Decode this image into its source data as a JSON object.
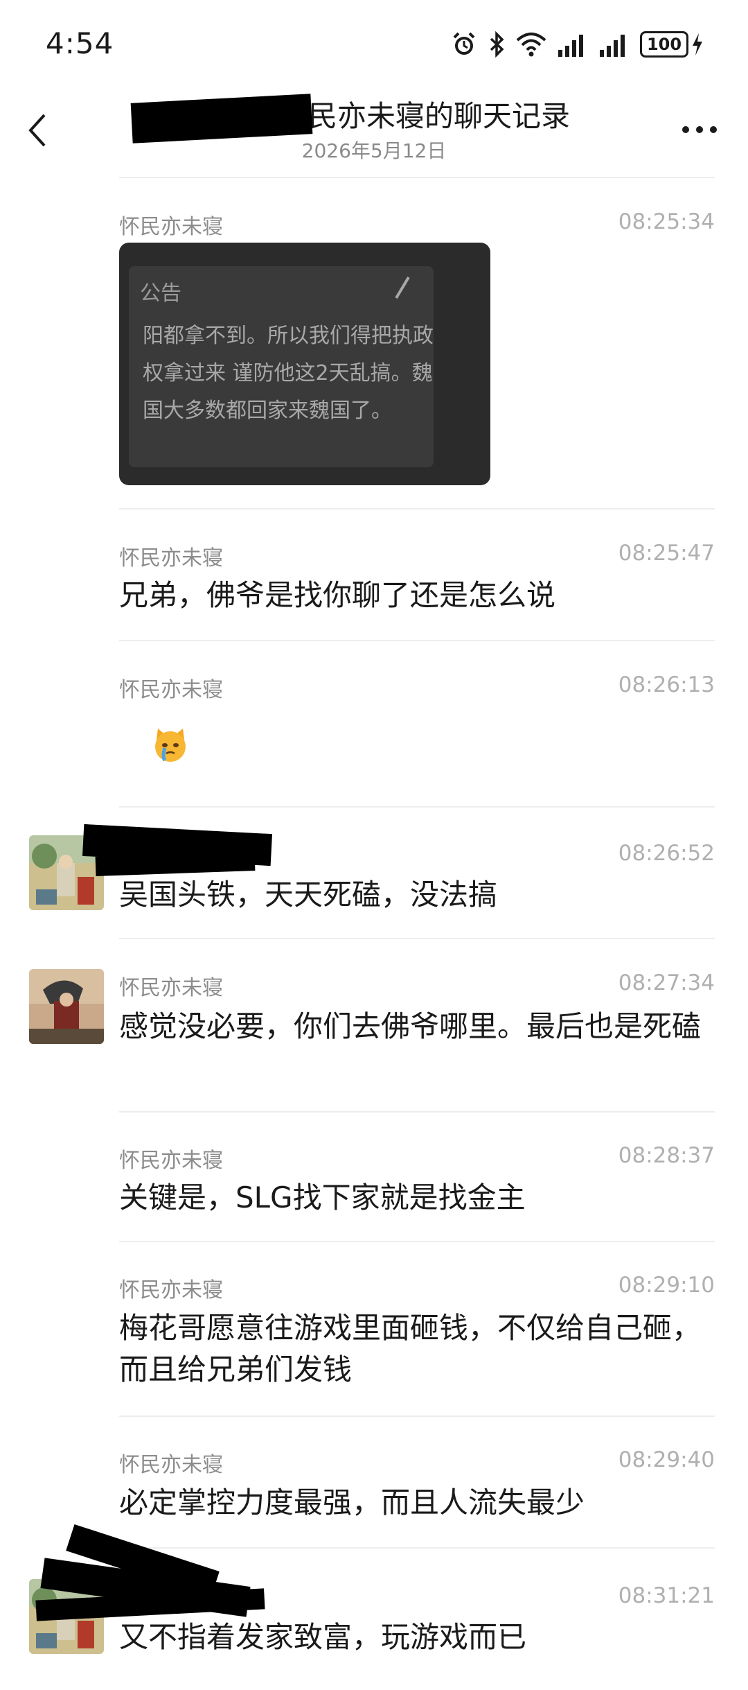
{
  "status_bar": {
    "time": "4:54",
    "battery": "100"
  },
  "header": {
    "title": "民亦未寝的聊天记录",
    "subtitle": "2026年5月12日"
  },
  "messages": [
    {
      "sender": "怀民亦未寝",
      "time": "08:25:34",
      "type": "image",
      "image": {
        "heading": "公告",
        "body": "阳都拿不到。所以我们得把执政权拿过来 谨防他这2天乱搞。魏国大多数都回家来魏国了。"
      }
    },
    {
      "sender": "怀民亦未寝",
      "time": "08:25:47",
      "type": "text",
      "text": "兄弟，佛爷是找你聊了还是怎么说"
    },
    {
      "sender": "怀民亦未寝",
      "time": "08:26:13",
      "type": "emoji",
      "emoji": "crying-cat-emoji"
    },
    {
      "sender": "",
      "time": "08:26:52",
      "type": "text",
      "text": "吴国头铁，天天死磕，没法搞"
    },
    {
      "sender": "怀民亦未寝",
      "time": "08:27:34",
      "type": "text",
      "text": "感觉没必要，你们去佛爷哪里。最后也是死磕"
    },
    {
      "sender": "怀民亦未寝",
      "time": "08:28:37",
      "type": "text",
      "text": "关键是，SLG找下家就是找金主"
    },
    {
      "sender": "怀民亦未寝",
      "time": "08:29:10",
      "type": "text",
      "text": "梅花哥愿意往游戏里面砸钱，不仅给自己砸，而且给兄弟们发钱"
    },
    {
      "sender": "怀民亦未寝",
      "time": "08:29:40",
      "type": "text",
      "text": "必定掌控力度最强，而且人流失最少"
    },
    {
      "sender": "",
      "time": "08:31:21",
      "type": "text",
      "text": "又不指着发家致富，玩游戏而已"
    }
  ]
}
